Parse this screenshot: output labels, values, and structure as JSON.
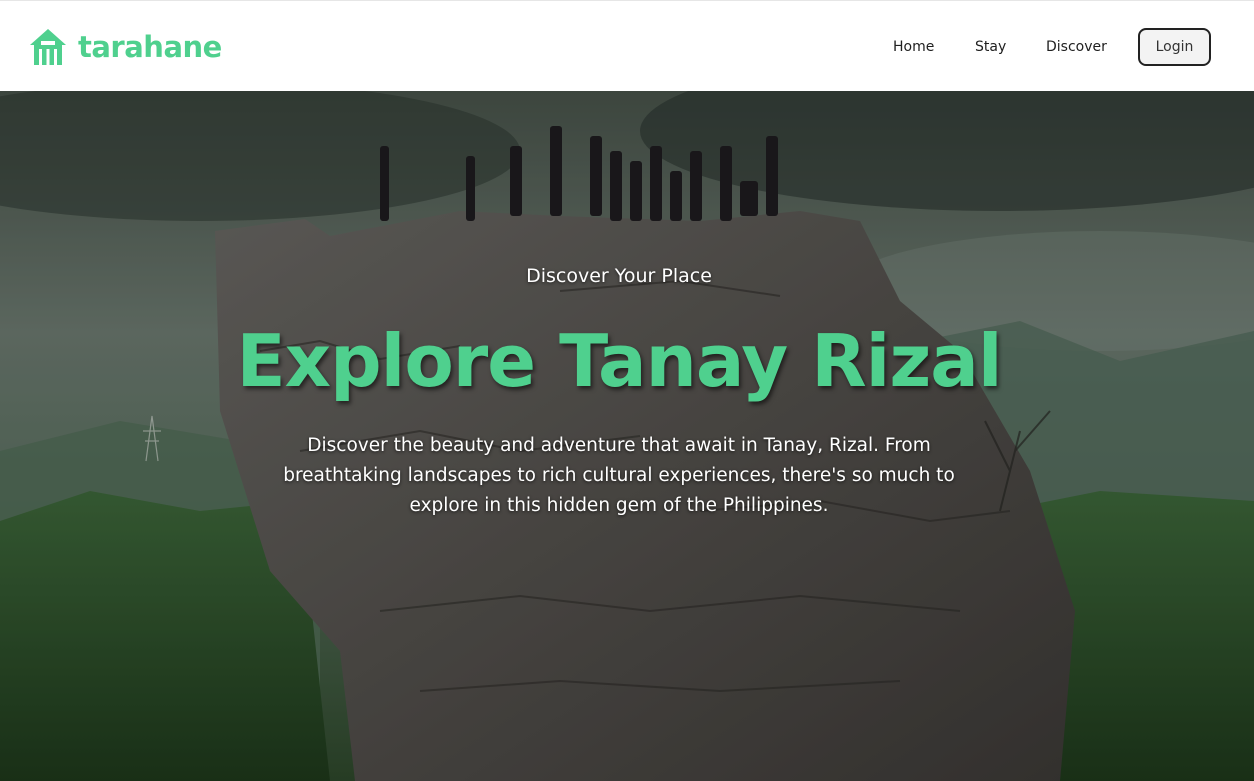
{
  "brand": {
    "name": "tarahane",
    "icon": "house-icon",
    "color": "#4fd08e"
  },
  "nav": {
    "links": [
      {
        "label": "Home"
      },
      {
        "label": "Stay"
      },
      {
        "label": "Discover"
      }
    ],
    "login_label": "Login"
  },
  "hero": {
    "eyebrow": "Discover Your Place",
    "title": "Explore Tanay Rizal",
    "description": "Discover the beauty and adventure that await in Tanay, Rizal. From breathtaking landscapes to rich cultural experiences, there's so much to explore in this hidden gem of the Philippines.",
    "accent_color": "#4fd08e"
  }
}
